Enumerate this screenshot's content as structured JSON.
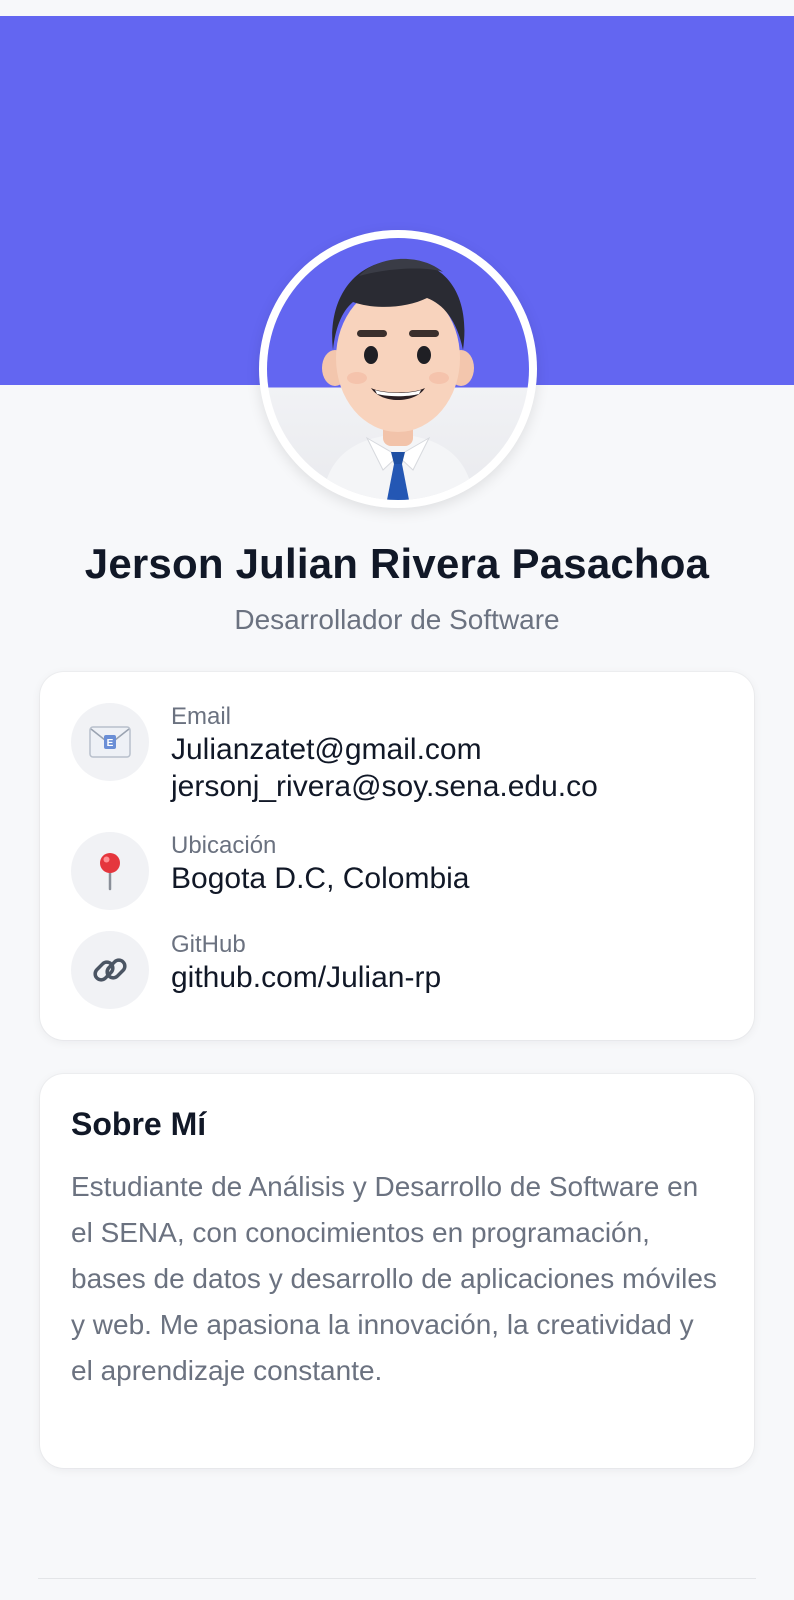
{
  "profile": {
    "name": "Jerson Julian Rivera Pasachoa",
    "role": "Desarrollador de Software"
  },
  "contact": {
    "email": {
      "icon": "envelope-icon",
      "label": "Email",
      "values": [
        "Julianzatet@gmail.com",
        "jersonj_rivera@soy.sena.edu.co"
      ]
    },
    "location": {
      "icon": "pin-icon",
      "label": "Ubicación",
      "value": "Bogota D.C, Colombia"
    },
    "github": {
      "icon": "link-icon",
      "label": "GitHub",
      "value": "github.com/Julian-rp"
    }
  },
  "about": {
    "title": "Sobre Mí",
    "text": "Estudiante de Análisis y Desarrollo de Software en el SENA, con conocimientos en programación, bases de datos y desarrollo de aplicaciones móviles y web. Me apasiona la innovación, la creatividad y el aprendizaje constante."
  },
  "colors": {
    "banner": "#6366f1",
    "background": "#f7f8fa",
    "text_primary": "#111827",
    "text_secondary": "#6b7280"
  }
}
